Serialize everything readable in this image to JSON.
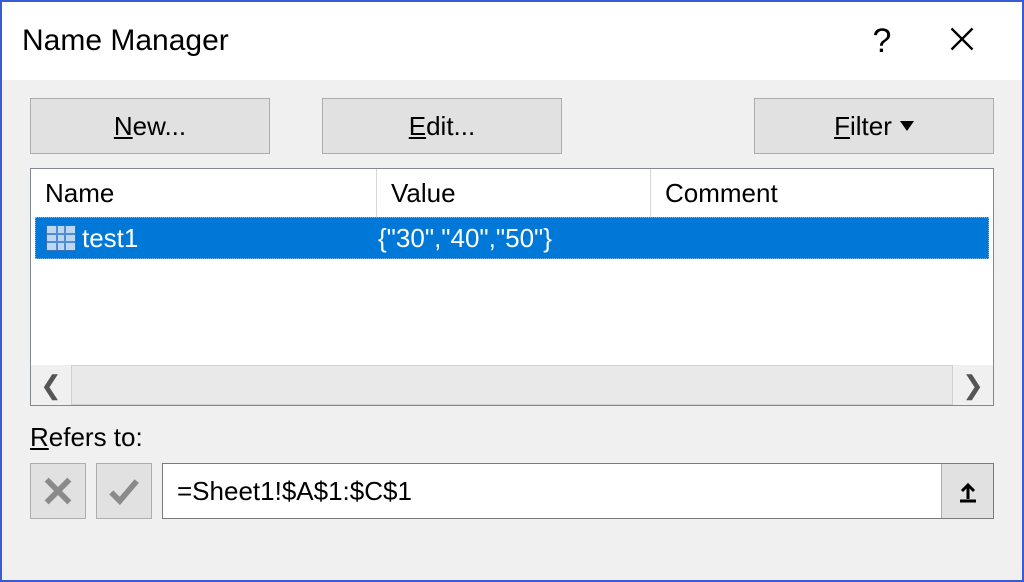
{
  "title": "Name Manager",
  "buttons": {
    "new_prefix": "N",
    "new_rest": "ew...",
    "edit_prefix": "E",
    "edit_rest": "dit...",
    "filter_prefix": "F",
    "filter_rest": "ilter"
  },
  "columns": {
    "name": "Name",
    "value": "Value",
    "comment": "Comment"
  },
  "rows": [
    {
      "name": "test1",
      "value": "{\"30\",\"40\",\"50\"}",
      "comment": ""
    }
  ],
  "refers_to": {
    "label_prefix": "R",
    "label_rest": "efers to:",
    "value": "=Sheet1!$A$1:$C$1"
  }
}
